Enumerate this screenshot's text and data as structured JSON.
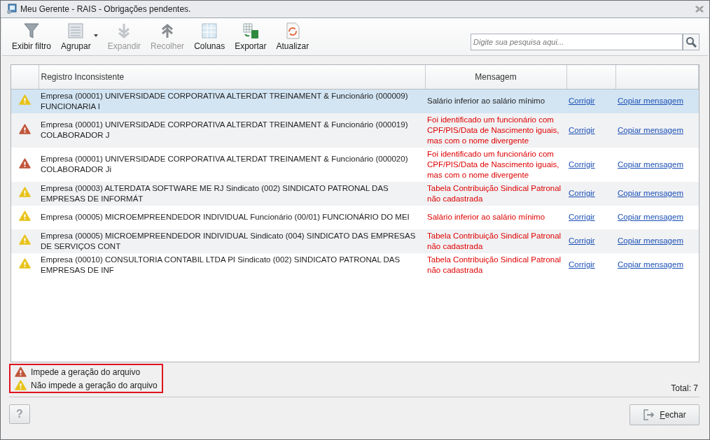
{
  "window": {
    "title": "Meu Gerente - RAIS - Obrigações pendentes."
  },
  "toolbar": [
    {
      "label": "Exibir filtro",
      "kind": "filter",
      "disabled": false,
      "has_menu": false
    },
    {
      "label": "Agrupar",
      "kind": "group",
      "disabled": false,
      "has_menu": true
    },
    {
      "label": "Expandir",
      "kind": "expand",
      "disabled": true,
      "has_menu": false
    },
    {
      "label": "Recolher",
      "kind": "collapse",
      "disabled": true,
      "has_menu": false
    },
    {
      "label": "Colunas",
      "kind": "columns",
      "disabled": false,
      "has_menu": false
    },
    {
      "label": "Exportar",
      "kind": "export",
      "disabled": false,
      "has_menu": false
    },
    {
      "label": "Atualizar",
      "kind": "refresh",
      "disabled": false,
      "has_menu": false
    }
  ],
  "search": {
    "placeholder": "Digite sua pesquisa aqui..."
  },
  "table": {
    "columns": [
      "Registro Inconsistente",
      "Mensagem"
    ],
    "rows": [
      {
        "kind": "warning",
        "selected": true,
        "registro": "Empresa (00001) UNIVERSIDADE CORPORATIVA ALTERDAT TREINAMENT & Funcionário (000009) FUNCIONARIA I",
        "mensagem": "Salário inferior ao salário mínimo",
        "fix": "Corrigir",
        "copy": "Copiar mensagem"
      },
      {
        "kind": "blocking",
        "selected": false,
        "registro": "Empresa (00001) UNIVERSIDADE CORPORATIVA ALTERDAT TREINAMENT & Funcionário (000019) COLABORADOR J",
        "mensagem": "Foi identificado um funcionário com CPF/PIS/Data de Nascimento iguais, mas com o nome divergente",
        "fix": "Corrigir",
        "copy": "Copiar mensagem"
      },
      {
        "kind": "blocking",
        "selected": false,
        "registro": "Empresa (00001) UNIVERSIDADE CORPORATIVA ALTERDAT TREINAMENT & Funcionário (000020) COLABORADOR Ji",
        "mensagem": "Foi identificado um funcionário com CPF/PIS/Data de Nascimento iguais, mas com o nome divergente",
        "fix": "Corrigir",
        "copy": "Copiar mensagem"
      },
      {
        "kind": "warning",
        "selected": false,
        "registro": "Empresa (00003) ALTERDATA SOFTWARE ME RJ Sindicato (002) SINDICATO PATRONAL DAS EMPRESAS DE INFORMÁT",
        "mensagem": "Tabela Contribuição Sindical Patronal não cadastrada",
        "fix": "Corrigir",
        "copy": "Copiar mensagem"
      },
      {
        "kind": "warning",
        "selected": false,
        "registro": "Empresa (00005) MICROEMPREENDEDOR INDIVIDUAL Funcionário (00/01) FUNCIONÁRIO DO MEI",
        "mensagem": "Salário inferior ao salário mínimo",
        "fix": "Corrigir",
        "copy": "Copiar mensagem"
      },
      {
        "kind": "warning",
        "selected": false,
        "registro": "Empresa (00005) MICROEMPREENDEDOR INDIVIDUAL Sindicato (004) SINDICATO DAS EMPRESAS DE SERVIÇOS CONT",
        "mensagem": "Tabela Contribuição Sindical Patronal não cadastrada",
        "fix": "Corrigir",
        "copy": "Copiar mensagem"
      },
      {
        "kind": "warning",
        "selected": false,
        "registro": "Empresa (00010) CONSULTORIA CONTABIL LTDA  PI Sindicato (002) SINDICATO PATRONAL DAS EMPRESAS DE INF",
        "mensagem": "Tabela Contribuição Sindical Patronal não cadastrada",
        "fix": "Corrigir",
        "copy": "Copiar mensagem"
      }
    ]
  },
  "legend": [
    {
      "kind": "blocking",
      "label": "Impede a geração do arquivo"
    },
    {
      "kind": "warning",
      "label": "Não impede a geração do arquivo"
    }
  ],
  "total": "Total: 7",
  "help_button": "?",
  "close_button": "Fechar"
}
